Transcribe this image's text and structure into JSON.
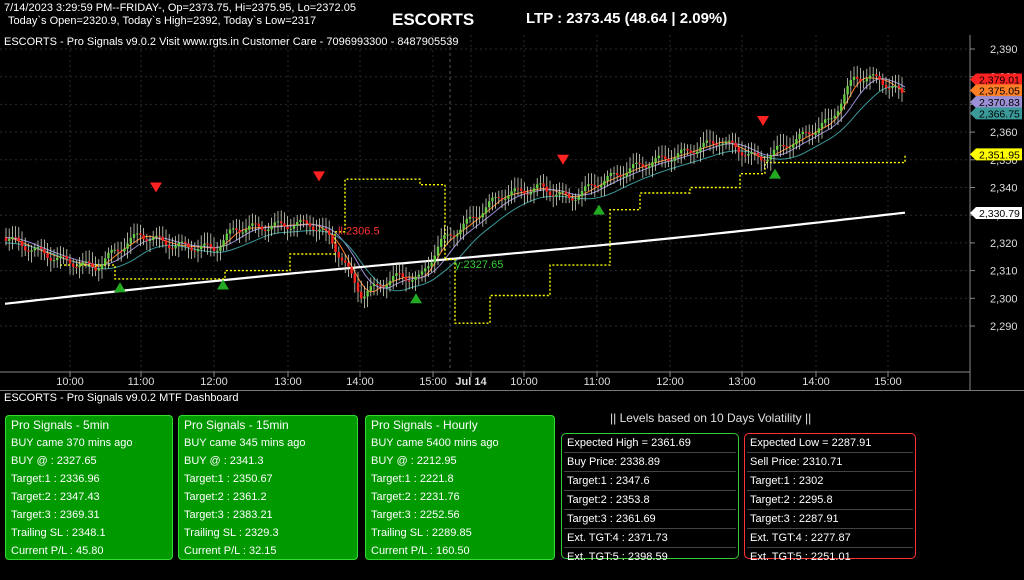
{
  "header": {
    "line1": "7/14/2023 3:29:59 PM--FRIDAY-, Op=2373.75, Hi=2375.95, Lo=2372.05",
    "line2": "Today`s Open=2320.9, Today`s High=2392, Today`s Low=2317",
    "symbol": "ESCORTS",
    "ltp": "LTP : 2373.45 (48.64 | 2.09%)"
  },
  "chart": {
    "caption": "ESCORTS - Pro Signals v9.0.2  Visit www.rgts.in Customer Care - 7096993300 - 8487905539",
    "y_ticks": [
      "2,390",
      "2,380",
      "2,370",
      "2,360",
      "2,350",
      "2,340",
      "2,330",
      "2,320",
      "2,310",
      "2,300",
      "2,290"
    ],
    "x_ticks": [
      "10:00",
      "11:00",
      "12:00",
      "13:00",
      "14:00",
      "15:00",
      "Jul 14",
      "10:00",
      "11:00",
      "12:00",
      "13:00",
      "14:00",
      "15:00"
    ],
    "price_badges": [
      {
        "label": "2,379.01",
        "value": 2379.01,
        "bg": "#ff2222",
        "fg": "#000000"
      },
      {
        "label": "2,375.05",
        "value": 2375.05,
        "bg": "#ff7f27",
        "fg": "#000000"
      },
      {
        "label": "2,370.83",
        "value": 2370.83,
        "bg": "#9b8fd6",
        "fg": "#000000"
      },
      {
        "label": "2,366.75",
        "value": 2366.75,
        "bg": "#3a9a9a",
        "fg": "#000000"
      },
      {
        "label": "2,351.95",
        "value": 2351.95,
        "bg": "#ffff00",
        "fg": "#000000"
      },
      {
        "label": "2,330.79",
        "value": 2330.79,
        "bg": "#ffffff",
        "fg": "#000000"
      }
    ],
    "signal_labels": [
      {
        "text": "ll:2306.5",
        "x": 338,
        "value": 2323,
        "color": "#ff3333"
      },
      {
        "text": "y:2327.65",
        "x": 455,
        "value": 2311,
        "color": "#33cc33"
      }
    ],
    "colors": {
      "bull": "#66cc44",
      "bear": "#ff2222",
      "hl_bull": "#ffff66",
      "hl_bear": "#3366ff",
      "trail": "#ffff00",
      "ma200": "#ffffff",
      "ema1": "#ff7f27",
      "ema2": "#9b8fd6",
      "ema3": "#3a9a9a"
    }
  },
  "dashboard": {
    "title": "ESCORTS - Pro Signals v9.0.2 MTF Dashboard",
    "levels_title": "|| Levels based on 10 Days Volatility ||",
    "signals": [
      {
        "title": "Pro Signals - 5min",
        "rows": [
          "BUY came 370 mins ago",
          "BUY @   : 2327.65",
          "Target:1 : 2336.96",
          "Target:2 : 2347.43",
          "Target:3 : 2369.31",
          "Trailing SL : 2348.1",
          "Current P/L : 45.80"
        ]
      },
      {
        "title": "Pro Signals - 15min",
        "rows": [
          "BUY came 345 mins ago",
          "BUY @   : 2341.3",
          "Target:1 : 2350.67",
          "Target:2 : 2361.2",
          "Target:3 : 2383.21",
          "Trailing SL : 2329.3",
          "Current P/L : 32.15"
        ]
      },
      {
        "title": "Pro Signals - Hourly",
        "rows": [
          "BUY came 5400 mins ago",
          "BUY @   : 2212.95",
          "Target:1 : 2221.8",
          "Target:2 : 2231.76",
          "Target:3 : 2252.56",
          "Trailing SL : 2289.85",
          "Current P/L : 160.50"
        ]
      }
    ],
    "levels": [
      {
        "border": "#33cc33",
        "rows": [
          "Expected High = 2361.69",
          "Buy Price: 2338.89",
          "Target:1 : 2347.6",
          "Target:2 : 2353.8",
          "Target:3 : 2361.69",
          "Ext. TGT:4 : 2371.73",
          "Ext. TGT:5 : 2398.59"
        ]
      },
      {
        "border": "#ff3333",
        "rows": [
          "Expected Low = 2287.91",
          "Sell Price: 2310.71",
          "Target:1 : 2302",
          "Target:2 : 2295.8",
          "Target:3 : 2287.91",
          "Ext. TGT:4 : 2277.87",
          "Ext. TGT:5 : 2251.01"
        ]
      }
    ]
  }
}
